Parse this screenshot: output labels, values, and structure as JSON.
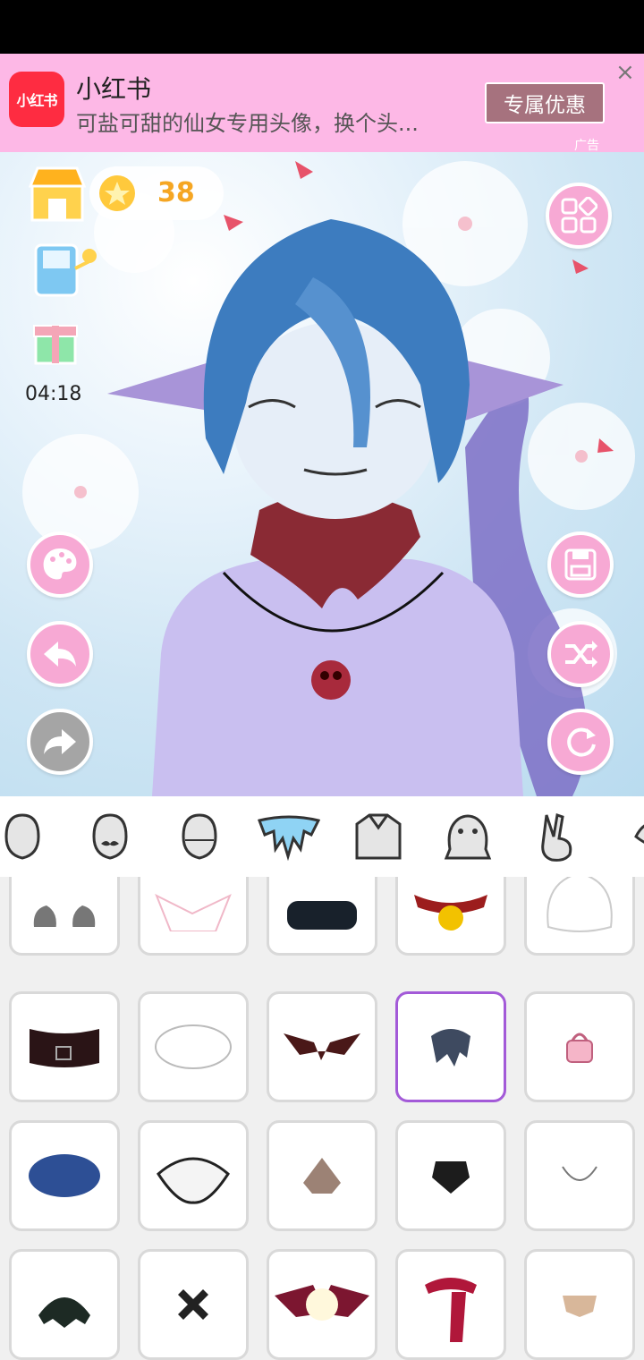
{
  "ad": {
    "logo_text": "小红书",
    "title": "小红书",
    "subtitle": "可盐可甜的仙女专用头像，换个头...",
    "button": "专属优惠",
    "close": "×",
    "tag": "广告"
  },
  "hud": {
    "coins": "38",
    "timer": "04:18"
  },
  "colors": {
    "accent_pink": "#f7a9d4",
    "selected_border": "#a35ad8",
    "ad_bg": "#fdb8e6"
  }
}
